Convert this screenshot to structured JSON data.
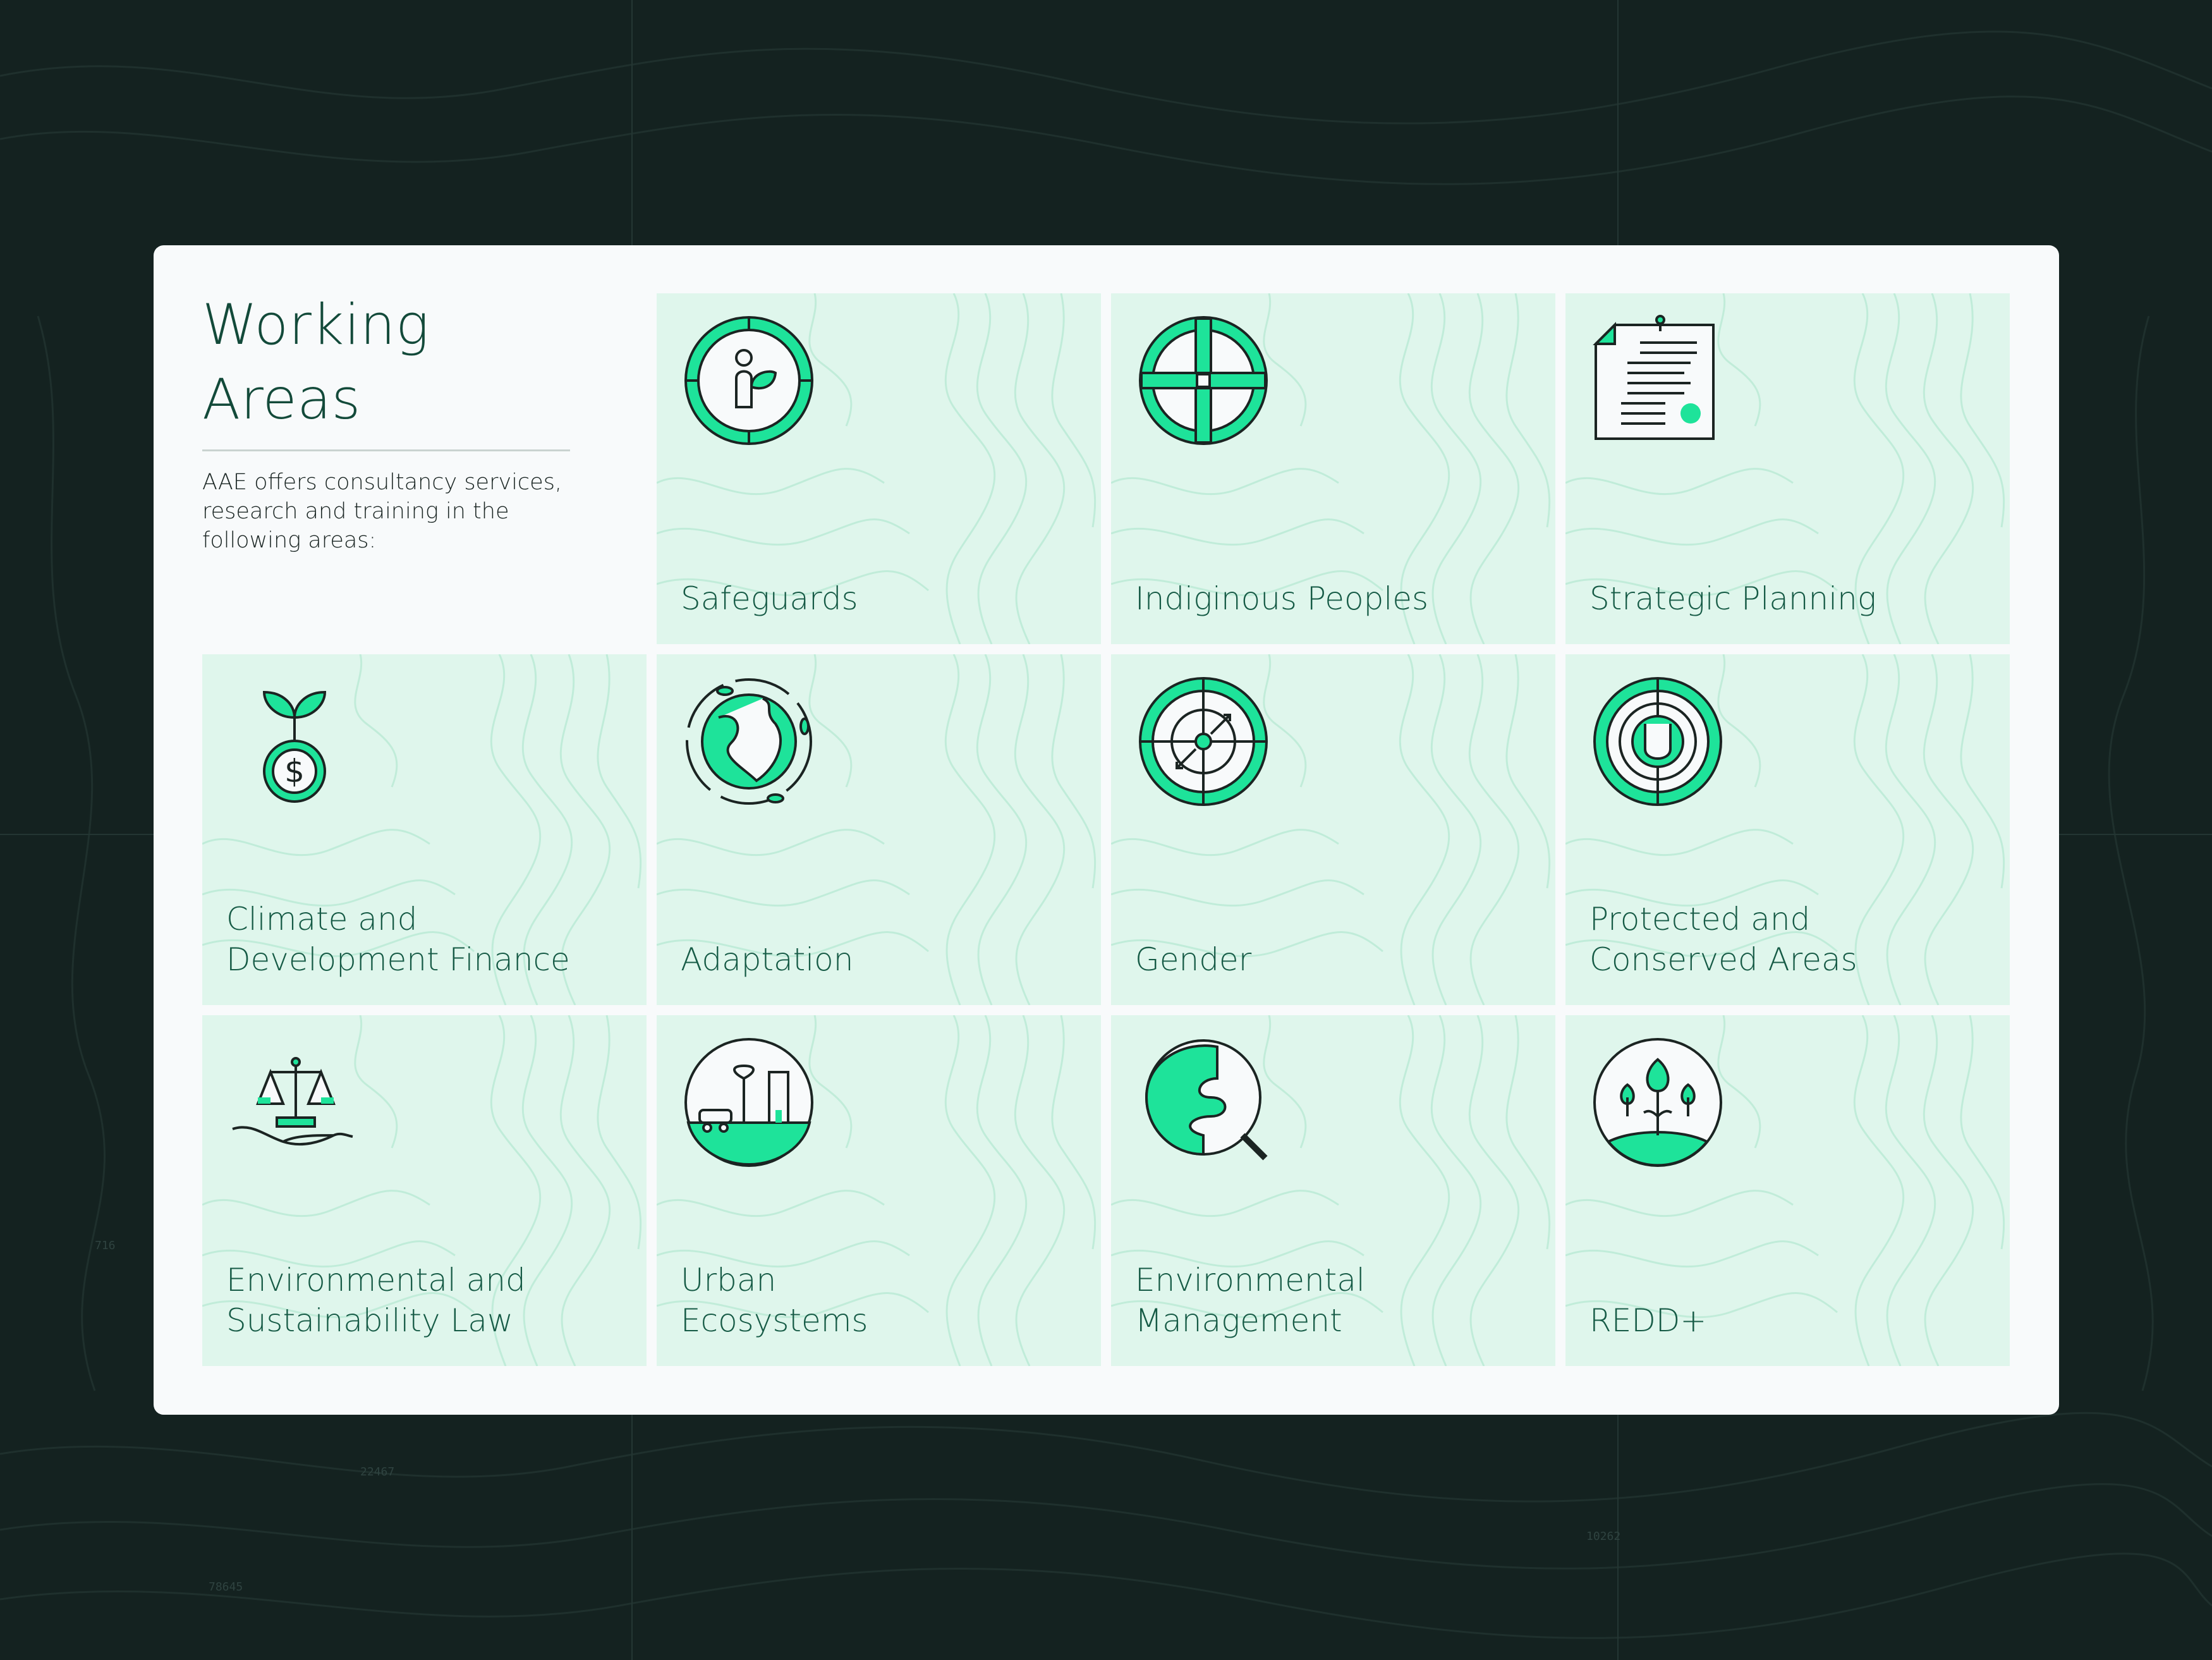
{
  "intro": {
    "title": "Working Areas",
    "description": "AAE offers consultancy services, research and training in the following areas:"
  },
  "colors": {
    "background": "#142220",
    "panel": "#f8fafb",
    "card": "#dff6ec",
    "accent": "#1ee39a",
    "text": "#155a45",
    "stroke": "#1b2422"
  },
  "map_markers": [
    "22467",
    "78645",
    "10262",
    "716"
  ],
  "areas": [
    {
      "label": "Safeguards",
      "icon": "person-sprout-shield-icon"
    },
    {
      "label": "Indiginous Peoples",
      "icon": "compass-cross-icon"
    },
    {
      "label": "Strategic Planning",
      "icon": "document-plan-icon"
    },
    {
      "label": "Climate and\nDevelopment Finance",
      "icon": "sprout-dollar-coin-icon"
    },
    {
      "label": "Adaptation",
      "icon": "globe-cycle-icon"
    },
    {
      "label": "Gender",
      "icon": "target-arrows-icon"
    },
    {
      "label": "Protected and\nConserved Areas",
      "icon": "protected-target-icon"
    },
    {
      "label": "Environmental and\nSustainability Law",
      "icon": "scales-hand-icon"
    },
    {
      "label": "Urban\nEcosystems",
      "icon": "urban-globe-icon"
    },
    {
      "label": "Environmental\nManagement",
      "icon": "globe-magnifier-icon"
    },
    {
      "label": "REDD+",
      "icon": "trees-globe-icon"
    }
  ]
}
